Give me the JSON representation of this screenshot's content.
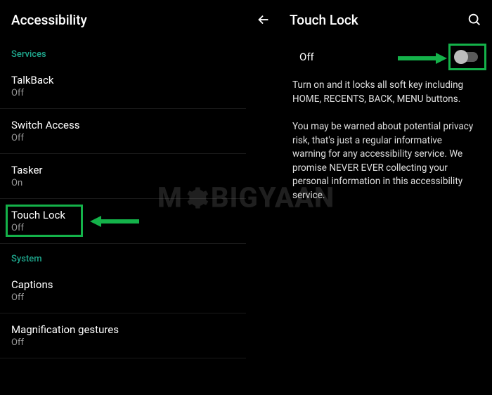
{
  "left": {
    "title": "Accessibility",
    "sections": [
      {
        "header": "Services",
        "items": [
          {
            "title": "TalkBack",
            "sub": "Off"
          },
          {
            "title": "Switch Access",
            "sub": "Off"
          },
          {
            "title": "Tasker",
            "sub": "On"
          },
          {
            "title": "Touch Lock",
            "sub": "Off"
          }
        ]
      },
      {
        "header": "System",
        "items": [
          {
            "title": "Captions",
            "sub": "Off"
          },
          {
            "title": "Magnification gestures",
            "sub": "Off"
          }
        ]
      }
    ]
  },
  "right": {
    "title": "Touch Lock",
    "toggle_label": "Off",
    "desc1": "Turn on and it locks all soft key including HOME, RECENTS, BACK, MENU buttons.",
    "desc2": "You may be warned about potential privacy risk, that's just a regular informative warning for any accessibility service. We promise NEVER EVER collecting your personal information in this accessibility service."
  },
  "watermark": {
    "pre": "M",
    "post": "BIGYAAN"
  }
}
